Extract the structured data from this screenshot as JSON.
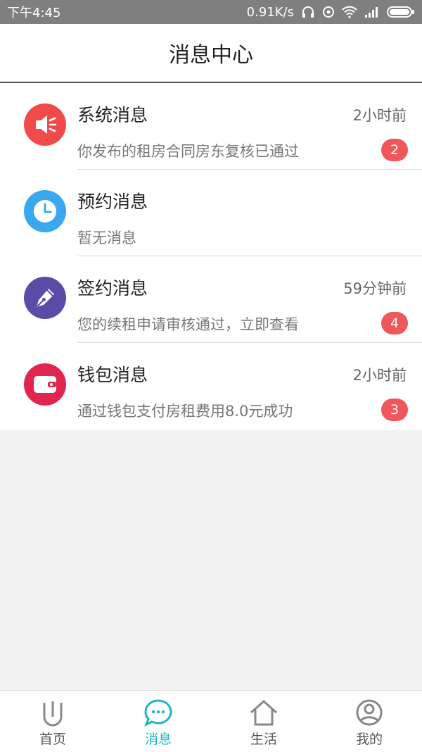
{
  "status_bar": {
    "time": "下午4:45",
    "network_speed": "0.91K/s",
    "icons": [
      "headset-icon",
      "sync-icon",
      "wifi-icon",
      "signal-icon",
      "battery-icon"
    ]
  },
  "header": {
    "title": "消息中心"
  },
  "messages": [
    {
      "icon": "speaker-icon",
      "color": "#f04a4a",
      "title": "系统消息",
      "time": "2小时前",
      "subtitle": "你发布的租房合同房东复核已通过",
      "badge": "2"
    },
    {
      "icon": "clock-icon",
      "color": "#3aa8ef",
      "title": "预约消息",
      "time": "",
      "subtitle": "暂无消息",
      "badge": ""
    },
    {
      "icon": "pen-icon",
      "color": "#5b4aa6",
      "title": "签约消息",
      "time": "59分钟前",
      "subtitle": "您的续租申请审核通过，立即查看",
      "badge": "4"
    },
    {
      "icon": "wallet-icon",
      "color": "#e0254f",
      "title": "钱包消息",
      "time": "2小时前",
      "subtitle": "通过钱包支付房租费用8.0元成功",
      "badge": "3"
    }
  ],
  "badge_color": "#f0575a",
  "tabs": [
    {
      "icon": "home-u-icon",
      "label": "首页",
      "active": false
    },
    {
      "icon": "chat-bubble-icon",
      "label": "消息",
      "active": true
    },
    {
      "icon": "house-icon",
      "label": "生活",
      "active": false
    },
    {
      "icon": "user-icon",
      "label": "我的",
      "active": false
    }
  ],
  "accent_color": "#1fb6c4"
}
